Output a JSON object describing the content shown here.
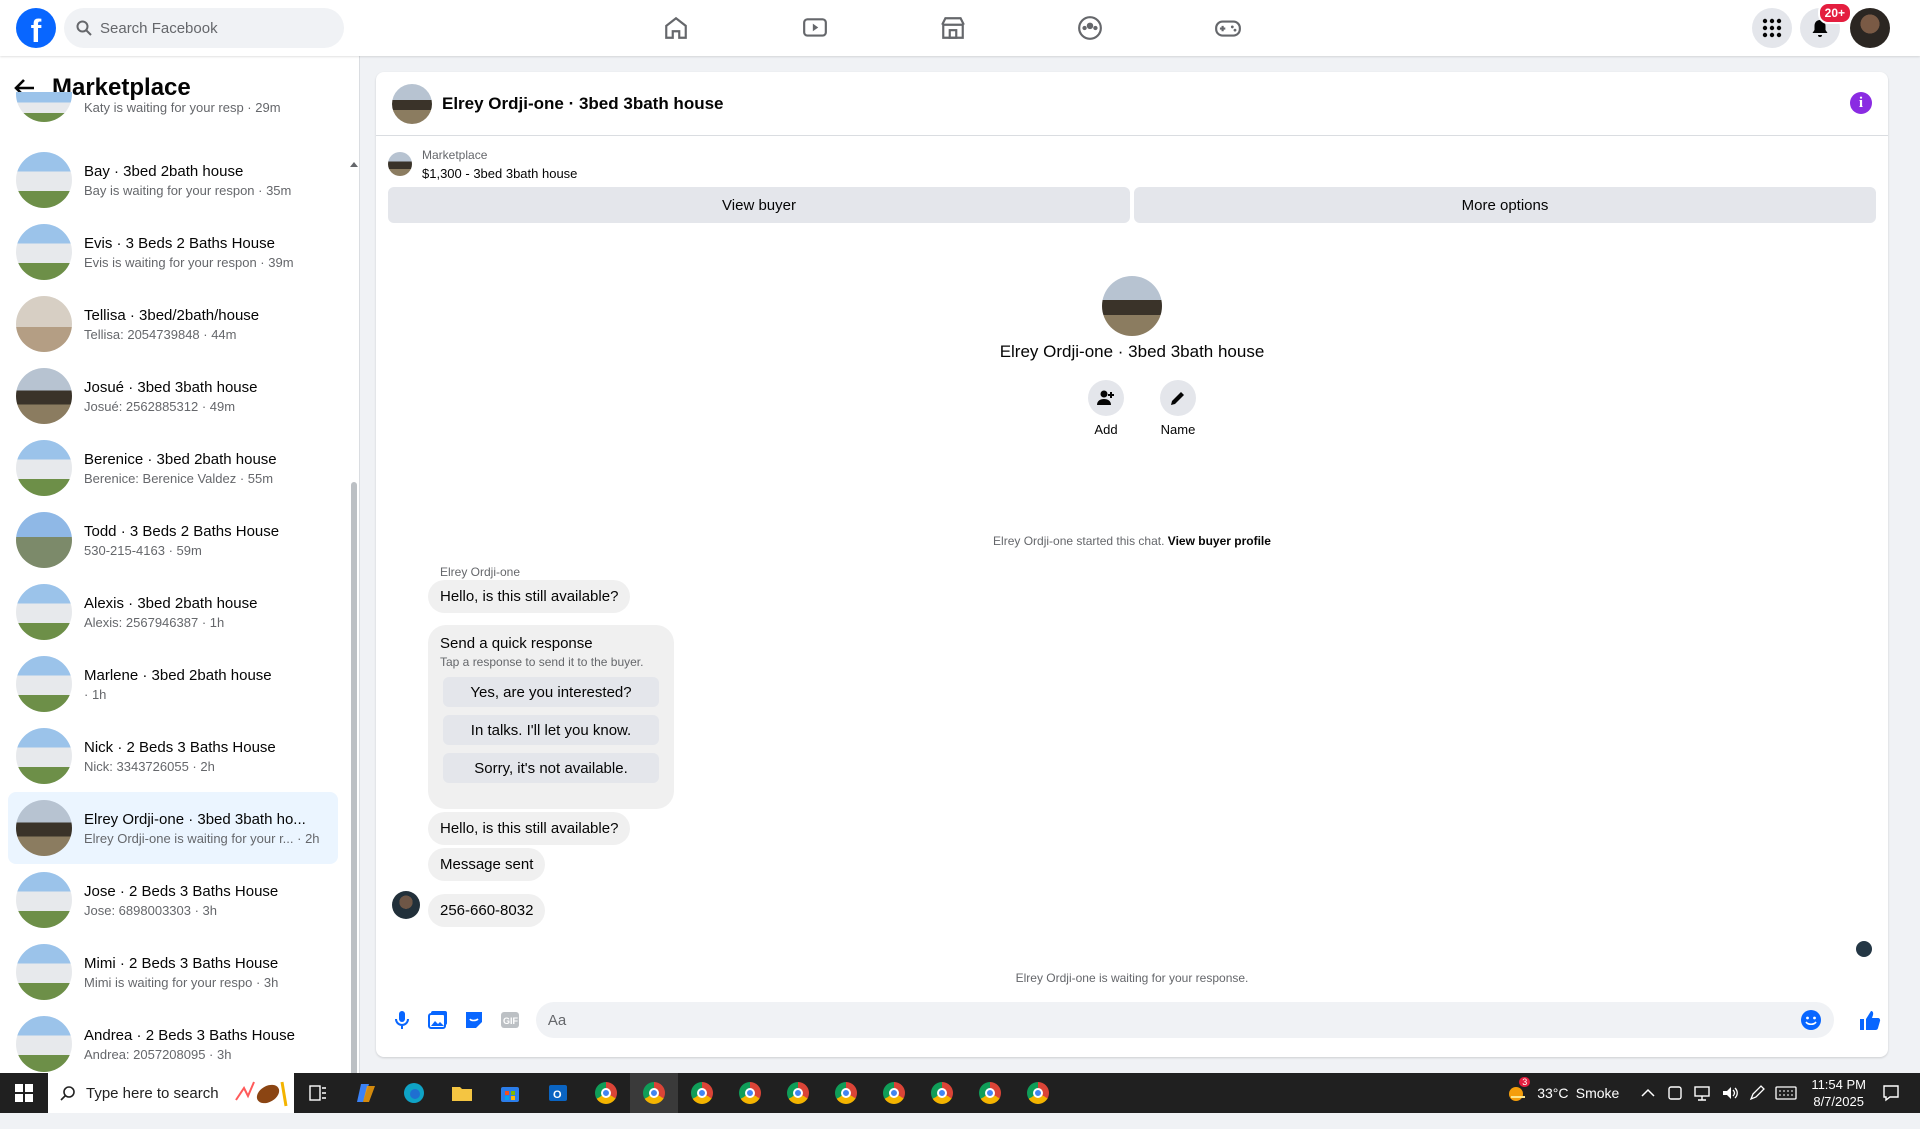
{
  "topbar": {
    "logo": "f",
    "search_placeholder": "Search Facebook",
    "notif_count": "20+",
    "nav_icons": [
      "home-icon",
      "video-icon",
      "marketplace-icon",
      "groups-icon",
      "gaming-icon"
    ]
  },
  "sidebar": {
    "title": "Marketplace",
    "conversations": [
      {
        "title": "Katy is waiting for your resp · 29m",
        "subtitle": ""
      },
      {
        "title": "Bay · 3bed 2bath house",
        "subtitle": "Bay is waiting for your respon · 35m"
      },
      {
        "title": "Evis · 3 Beds 2 Baths House",
        "subtitle": "Evis is waiting for your respon · 39m"
      },
      {
        "title": "Tellisa · 3bed/2bath/house",
        "subtitle": "Tellisa: 2054739848 · 44m"
      },
      {
        "title": "Josué · 3bed 3bath house",
        "subtitle": "Josué: 2562885312 · 49m"
      },
      {
        "title": "Berenice · 3bed 2bath house",
        "subtitle": "Berenice: Berenice Valdez · 55m"
      },
      {
        "title": "Todd · 3 Beds 2 Baths House",
        "subtitle": "530-215-4163 · 59m"
      },
      {
        "title": "Alexis · 3bed 2bath house",
        "subtitle": "Alexis: 2567946387 · 1h"
      },
      {
        "title": "Marlene · 3bed 2bath house",
        "subtitle": " · 1h"
      },
      {
        "title": "Nick · 2 Beds 3 Baths House",
        "subtitle": "Nick: 3343726055 · 2h"
      },
      {
        "title": "Elrey Ordji-one · 3bed 3bath ho...",
        "subtitle": "Elrey Ordji-one is waiting for your r... · 2h"
      },
      {
        "title": "Jose · 2 Beds 3 Baths House",
        "subtitle": "Jose: 6898003303 · 3h"
      },
      {
        "title": "Mimi · 2 Beds 3 Baths House",
        "subtitle": "Mimi is waiting for your respo · 3h"
      },
      {
        "title": "Andrea · 2 Beds 3 Baths House",
        "subtitle": "Andrea: 2057208095 · 3h"
      }
    ]
  },
  "chat": {
    "header_title": "Elrey Ordji-one · 3bed 3bath house",
    "marketplace_label": "Marketplace",
    "listing": "$1,300 - 3bed 3bath house",
    "view_buyer": "View buyer",
    "more_options": "More options",
    "center_title": "Elrey Ordji-one · 3bed 3bath house",
    "add_label": "Add",
    "name_label": "Name",
    "started_text": "Elrey Ordji-one started this chat.",
    "view_buyer_profile": "View buyer profile",
    "sender": "Elrey Ordji-one",
    "msg1": "Hello, is this still available?",
    "qr_title": "Send a quick response",
    "qr_sub": "Tap a response to send it to the buyer.",
    "qr1": "Yes, are you interested?",
    "qr2": "In talks. I'll let you know.",
    "qr3": "Sorry, it's not available.",
    "msg2": "Hello, is this still available?",
    "msg3": "Message sent",
    "msg4": "256-660-8032",
    "waiting": "Elrey Ordji-one is waiting for your response.",
    "input_placeholder": "Aa"
  },
  "taskbar": {
    "search": "Type here to search",
    "temp": "33°C",
    "weather": "Smoke",
    "time": "11:54 PM",
    "date": "8/7/2025",
    "weather_badge": "3"
  }
}
